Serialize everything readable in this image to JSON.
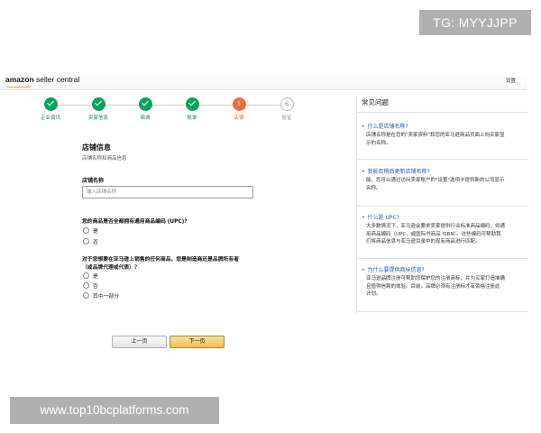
{
  "watermarks": {
    "tg": "TG: MYYJJPP",
    "url": "www.top10bcplatforms.com"
  },
  "header": {
    "logo_brand": "amazon",
    "logo_product": "seller central",
    "settings": "设置"
  },
  "steps": [
    {
      "label": "企业资讯",
      "state": "done"
    },
    {
      "label": "卖家信息",
      "state": "done"
    },
    {
      "label": "商城",
      "state": "done"
    },
    {
      "label": "账单",
      "state": "done"
    },
    {
      "label": "店铺",
      "state": "current",
      "number": "5"
    },
    {
      "label": "验证",
      "state": "todo",
      "number": "6"
    }
  ],
  "form": {
    "title": "店铺信息",
    "subtitle": "店铺名称和商品信息",
    "store_name_label": "店铺名称",
    "store_name_placeholder": "输入店铺名称",
    "upc_question": "您的商品是否全都拥有通用商品编码 (UPC)?",
    "upc_options": [
      "是",
      "否"
    ],
    "brand_question_line1": "对于您想要在亚马逊上销售的任何商品，您是制造商还是品牌所有者",
    "brand_question_line2": "（或品牌代理或代表）？",
    "brand_options": [
      "是",
      "否",
      "其中一部分"
    ]
  },
  "faq": {
    "title": "常见问题",
    "items": [
      {
        "q": "什么是店铺名称?",
        "a1": "店铺名称是在您的\"卖家资料\"和您的亚马逊商品页面上向买家显",
        "a2": "示的名称。"
      },
      {
        "q": "我能否稍后更新店铺名称?",
        "a1": "能。您可以通过访问卖家账户的\"设置\"选项卡提供新的公司显示",
        "a2": "名称。"
      },
      {
        "q": "什么是 UPC?",
        "a1": "大多数情况下，亚马逊会要求卖家提供行业标准商品编码，如通",
        "a2": "用商品编码（UPC，或国际书商品 ISBN）。这些编码可帮助我",
        "a3": "们将商品信息与亚马逊目录中的现有商品进行匹配。"
      },
      {
        "q": "为什么要提供商标信息?",
        "a1": "亚马逊品牌注册可帮助您保护您的注册商标，并为买家打造准确",
        "a2": "且值得信赖的体验。目前，品牌必须有注册标才有资格注册此",
        "a3": "计划。"
      }
    ]
  },
  "buttons": {
    "prev": "上一页",
    "next": "下一页"
  },
  "colors": {
    "step_done": "#0aa35a",
    "step_current": "#e8703a",
    "link": "#2156b8",
    "primary_button": "#f0c14b"
  }
}
